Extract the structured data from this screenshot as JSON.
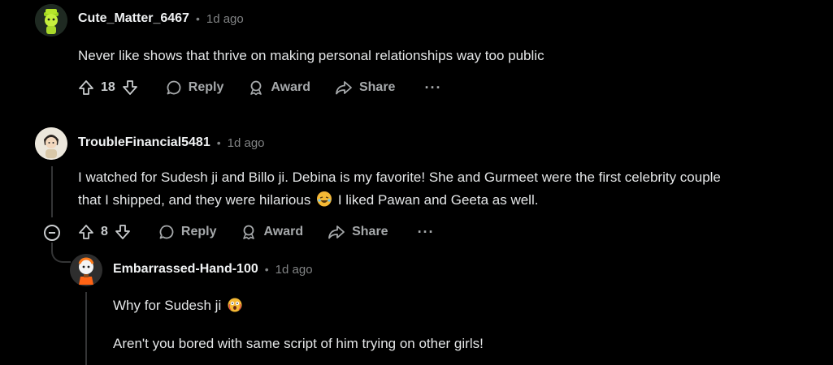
{
  "comments": [
    {
      "username": "Cute_Matter_6467",
      "time": "1d ago",
      "body": "Never like shows that thrive on making personal relationships way too public",
      "votes": "18",
      "reply_label": "Reply",
      "award_label": "Award",
      "share_label": "Share",
      "more_label": "···"
    },
    {
      "username": "TroubleFinancial5481",
      "time": "1d ago",
      "body_line1": "I watched for Sudesh ji and Billo ji. Debina is my favorite! She and Gurmeet were the first celebrity couple",
      "body_line2a": "that I shipped, and they were hilarious",
      "body_line2b": "I liked Pawan and Geeta as well.",
      "votes": "8",
      "reply_label": "Reply",
      "award_label": "Award",
      "share_label": "Share",
      "more_label": "···"
    },
    {
      "username": "Embarrassed-Hand-100",
      "time": "1d ago",
      "body_line1": "Why for Sudesh ji",
      "body_line2": "Aren't you bored with same script of him trying on other girls!"
    }
  ],
  "separator": "•",
  "colors": {
    "background": "#000000",
    "thread_line": "#343536",
    "text": "#e4e6e7",
    "muted": "#818384"
  }
}
